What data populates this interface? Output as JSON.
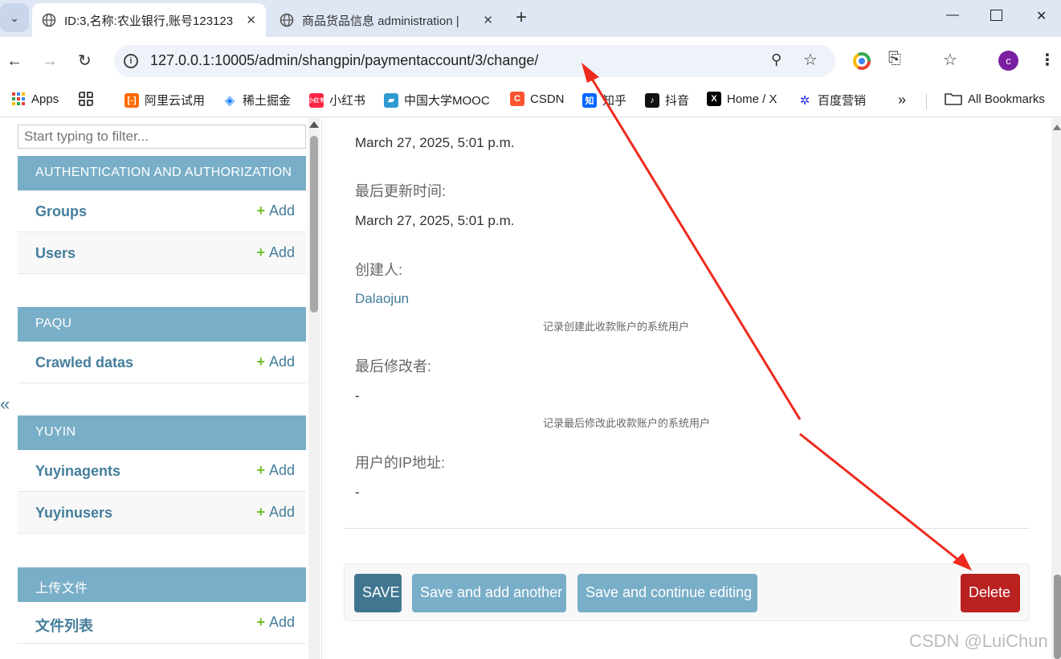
{
  "browser": {
    "tabs": [
      {
        "title": "ID:3,名称:农业银行,账号123123",
        "active": true
      },
      {
        "title": "商品货品信息 administration | ",
        "active": false
      }
    ],
    "url": "127.0.0.1:10005/admin/shangpin/paymentaccount/3/change/",
    "profile_initial": "c",
    "bookmarks": [
      {
        "label": "Apps"
      },
      {
        "label": ""
      },
      {
        "label": "阿里云试用"
      },
      {
        "label": "稀土掘金"
      },
      {
        "label": "小红书"
      },
      {
        "label": "中国大学MOOC"
      },
      {
        "label": "CSDN"
      },
      {
        "label": "知乎"
      },
      {
        "label": "抖音"
      },
      {
        "label": "Home / X"
      },
      {
        "label": "百度营销"
      }
    ],
    "more_bookmarks": "»",
    "all_bookmarks": "All Bookmarks"
  },
  "sidebar": {
    "filter_placeholder": "Start typing to filter...",
    "collapse": "«",
    "modules": [
      {
        "title": "AUTHENTICATION AND AUTHORIZATION",
        "models": [
          {
            "name": "Groups",
            "add": "Add"
          },
          {
            "name": "Users",
            "add": "Add"
          }
        ]
      },
      {
        "title": "PAQU",
        "models": [
          {
            "name": "Crawled datas",
            "add": "Add"
          }
        ]
      },
      {
        "title": "YUYIN",
        "models": [
          {
            "name": "Yuyinagents",
            "add": "Add"
          },
          {
            "name": "Yuyinusers",
            "add": "Add"
          }
        ]
      },
      {
        "title": "上传文件",
        "models": [
          {
            "name": "文件列表",
            "add": "Add"
          }
        ]
      }
    ],
    "plus": "+"
  },
  "form": {
    "created_value": "March 27, 2025, 5:01 p.m.",
    "updated_label": "最后更新时间:",
    "updated_value": "March 27, 2025, 5:01 p.m.",
    "creator_label": "创建人:",
    "creator_value": "Dalaojun",
    "creator_help": "记录创建此收款账户的系统用户",
    "modifier_label": "最后修改者:",
    "modifier_value": "-",
    "modifier_help": "记录最后修改此收款账户的系统用户",
    "ip_label": "用户的IP地址:",
    "ip_value": "-"
  },
  "submit": {
    "save": "SAVE",
    "save_add_another": "Save and add another",
    "save_continue": "Save and continue editing",
    "delete": "Delete"
  },
  "watermark": "CSDN @LuiChun",
  "colors": {
    "header_blue": "#79aec8",
    "link_blue": "#447e9b",
    "save_blue": "#417690",
    "delete_red": "#ba2121",
    "annotation_red": "#ee2a1e"
  }
}
